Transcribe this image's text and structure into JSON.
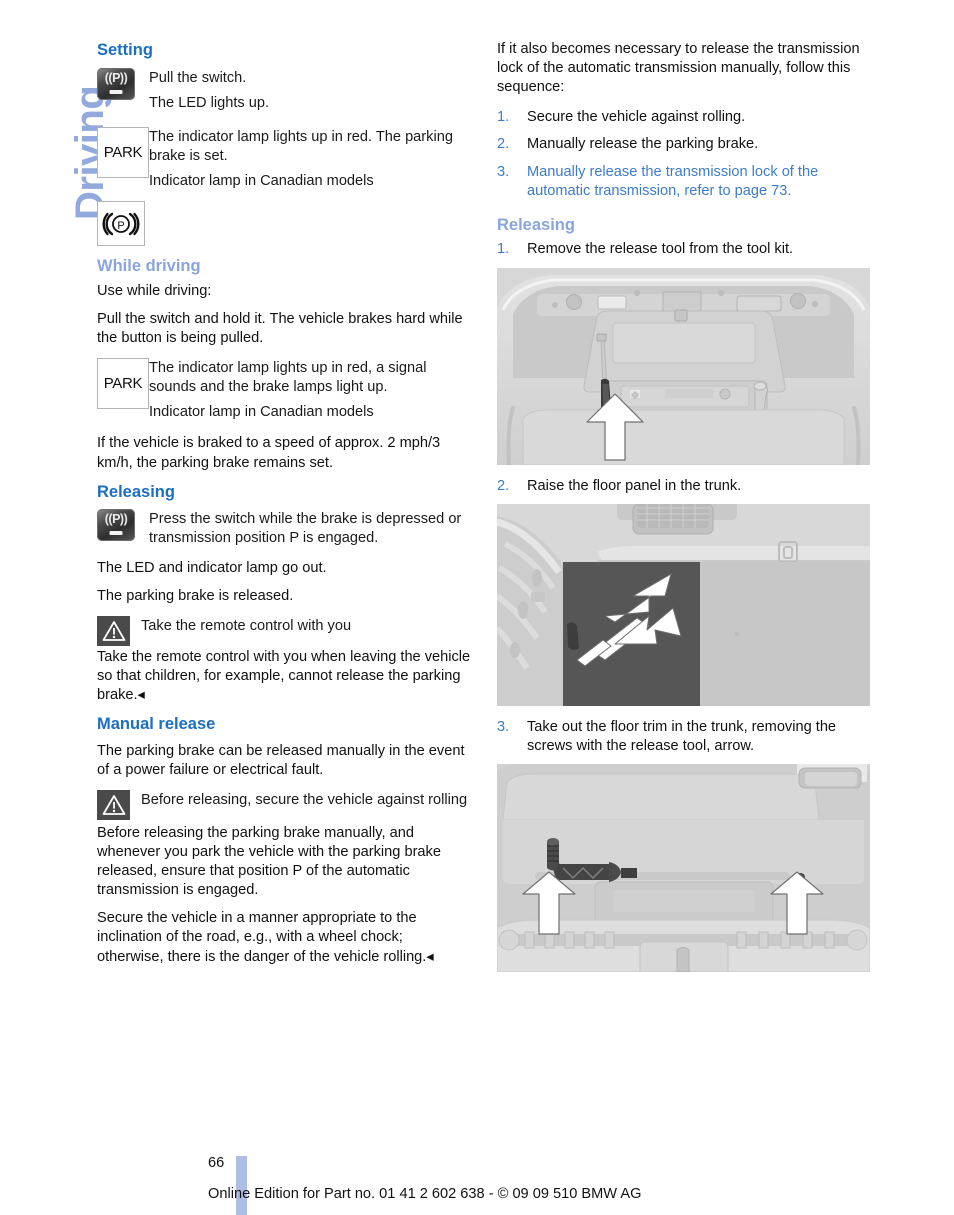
{
  "chapter": {
    "tab_label": "Driving"
  },
  "left_column": {
    "setting": {
      "heading": "Setting",
      "switch_icon_label": "park-brake-switch",
      "switch_lines": [
        "Pull the switch.",
        "The LED lights up."
      ],
      "park_box_label": "PARK",
      "park_text": "The indicator lamp lights up in red. The parking brake is set.",
      "canadian_note": "Indicator lamp in Canadian models",
      "brake_symbol_label": "((P))"
    },
    "while_driving": {
      "heading": "While driving",
      "intro": "Use while driving:",
      "para1": "Pull the switch and hold it. The vehicle brakes hard while the button is being pulled.",
      "park_box_label": "PARK",
      "park_text": "The indicator lamp lights up in red, a signal sounds and the brake lamps light up.",
      "canadian_note": "Indicator lamp in Canadian models",
      "para2": "If the vehicle is braked to a speed of approx. 2 mph/3 km/h, the parking brake remains set."
    },
    "releasing": {
      "heading": "Releasing",
      "switch_text": "Press the switch while the brake is depressed or transmission position P is engaged.",
      "para1": "The LED and indicator lamp go out.",
      "para2": "The parking brake is released.",
      "warning_title": "Take the remote control with you",
      "warning_body": "Take the remote control with you when leaving the vehicle so that children, for example, cannot release the parking brake.◂"
    },
    "manual_release": {
      "heading": "Manual release",
      "para1": "The parking brake can be released manually in the event of a power failure or electrical fault.",
      "warning_title": "Before releasing, secure the vehicle against rolling",
      "para2": "Before releasing the parking brake manually, and whenever you park the vehicle with the parking brake released, ensure that position P of the automatic transmission is engaged.",
      "para3": "Secure the vehicle in a manner appropriate to the inclination of the road, e.g., with a wheel chock; otherwise, there is the danger of the vehicle rolling.◂"
    }
  },
  "right_column": {
    "intro": "If it also becomes necessary to release the transmission lock of the automatic transmission manually, follow this sequence:",
    "sequence": [
      {
        "num": "1.",
        "text": "Secure the vehicle against rolling.",
        "xref": false
      },
      {
        "num": "2.",
        "text": "Manually release the parking brake.",
        "xref": false
      },
      {
        "num": "3.",
        "text": "Manually release the transmission lock of the automatic transmission, refer to page 73.",
        "xref": true
      }
    ],
    "releasing": {
      "heading": "Releasing",
      "steps": [
        {
          "num": "1.",
          "text": "Remove the release tool from the tool kit.",
          "figure": "trunk-lid-tool-kit"
        },
        {
          "num": "2.",
          "text": "Raise the floor panel in the trunk.",
          "figure": "trunk-floor-panel-raise"
        },
        {
          "num": "3.",
          "text": "Take out the floor trim in the trunk, removing the screws with the release tool, arrow.",
          "figure": "trunk-floor-trim-screws"
        }
      ]
    }
  },
  "footer": {
    "page_number": "66",
    "note": "Online Edition for Part no. 01 41 2 602 638 - © 09 09 510 BMW AG"
  },
  "colors": {
    "heading_blue": "#1c6fc0",
    "subheading_blue": "#8aa5dc",
    "xref_blue": "#3d7cc9",
    "tab_blue": "#aebde4",
    "chapter_blue": "#92a9de",
    "icon_dark": "#4a4a4a"
  }
}
